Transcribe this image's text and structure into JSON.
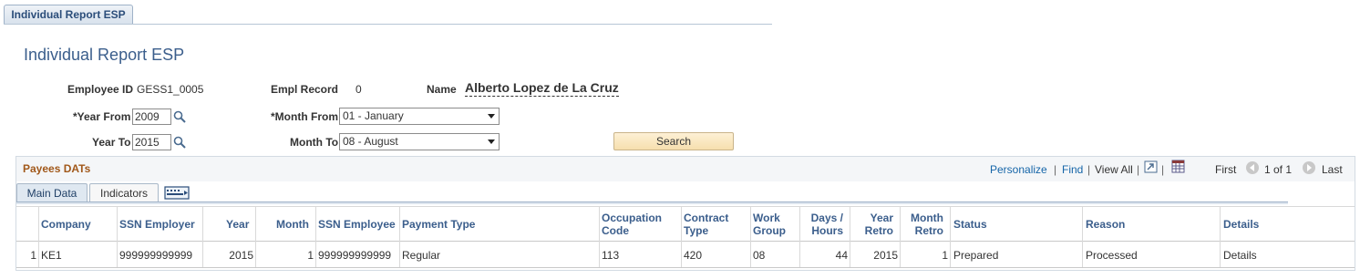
{
  "page_tab": {
    "label": "Individual Report ESP"
  },
  "title": "Individual Report ESP",
  "fields": {
    "employee_id_label": "Employee ID",
    "employee_id": "GESS1_0005",
    "empl_record_label": "Empl Record",
    "empl_record": "0",
    "name_label": "Name",
    "name": "Alberto Lopez de La Cruz",
    "year_from_label": "*Year From",
    "year_from": "2009",
    "year_to_label": "Year To",
    "year_to": "2015",
    "month_from_label": "*Month From",
    "month_from": "01 - January",
    "month_to_label": "Month To",
    "month_to": "08 - August"
  },
  "search_button": "Search",
  "grid": {
    "title": "Payees DATs",
    "nav": {
      "personalize": "Personalize",
      "sep": "|",
      "find": "Find",
      "view_all": "View All",
      "first": "First",
      "range": "1 of 1",
      "last": "Last"
    },
    "tabs": [
      "Main Data",
      "Indicators"
    ],
    "columns": {
      "company": "Company",
      "ssn_employer": "SSN Employer",
      "year": "Year",
      "month": "Month",
      "ssn_employee": "SSN Employee",
      "payment_type": "Payment Type",
      "occupation_code": [
        "Occupation",
        "Code"
      ],
      "contract_type": [
        "Contract",
        "Type"
      ],
      "work_group": [
        "Work",
        "Group"
      ],
      "days_hours": [
        "Days /",
        "Hours"
      ],
      "year_retro": [
        "Year",
        "Retro"
      ],
      "month_retro": [
        "Month",
        "Retro"
      ],
      "status": "Status",
      "reason": "Reason",
      "details": "Details"
    },
    "rows": [
      {
        "num": "1",
        "company": "KE1",
        "ssn_employer": "999999999999",
        "year": "2015",
        "month": "1",
        "ssn_employee": "999999999999",
        "payment_type": "Regular",
        "occupation_code": "113",
        "contract_type": "420",
        "work_group": "08",
        "days_hours": "44",
        "year_retro": "2015",
        "month_retro": "1",
        "status": "Prepared",
        "reason": "Processed",
        "details": "Details"
      }
    ]
  },
  "icons": {
    "lookup": "magnifier-icon",
    "zoom": "zoom-grid-icon",
    "download": "download-excel-icon",
    "show_all_columns": "show-all-columns-icon",
    "prev": "previous-arrow-icon",
    "next": "next-arrow-icon"
  },
  "colors": {
    "title": "#3b5e8c",
    "grid_title": "#a1581a",
    "link": "#1565a8",
    "search_button": "#f6dfae"
  }
}
